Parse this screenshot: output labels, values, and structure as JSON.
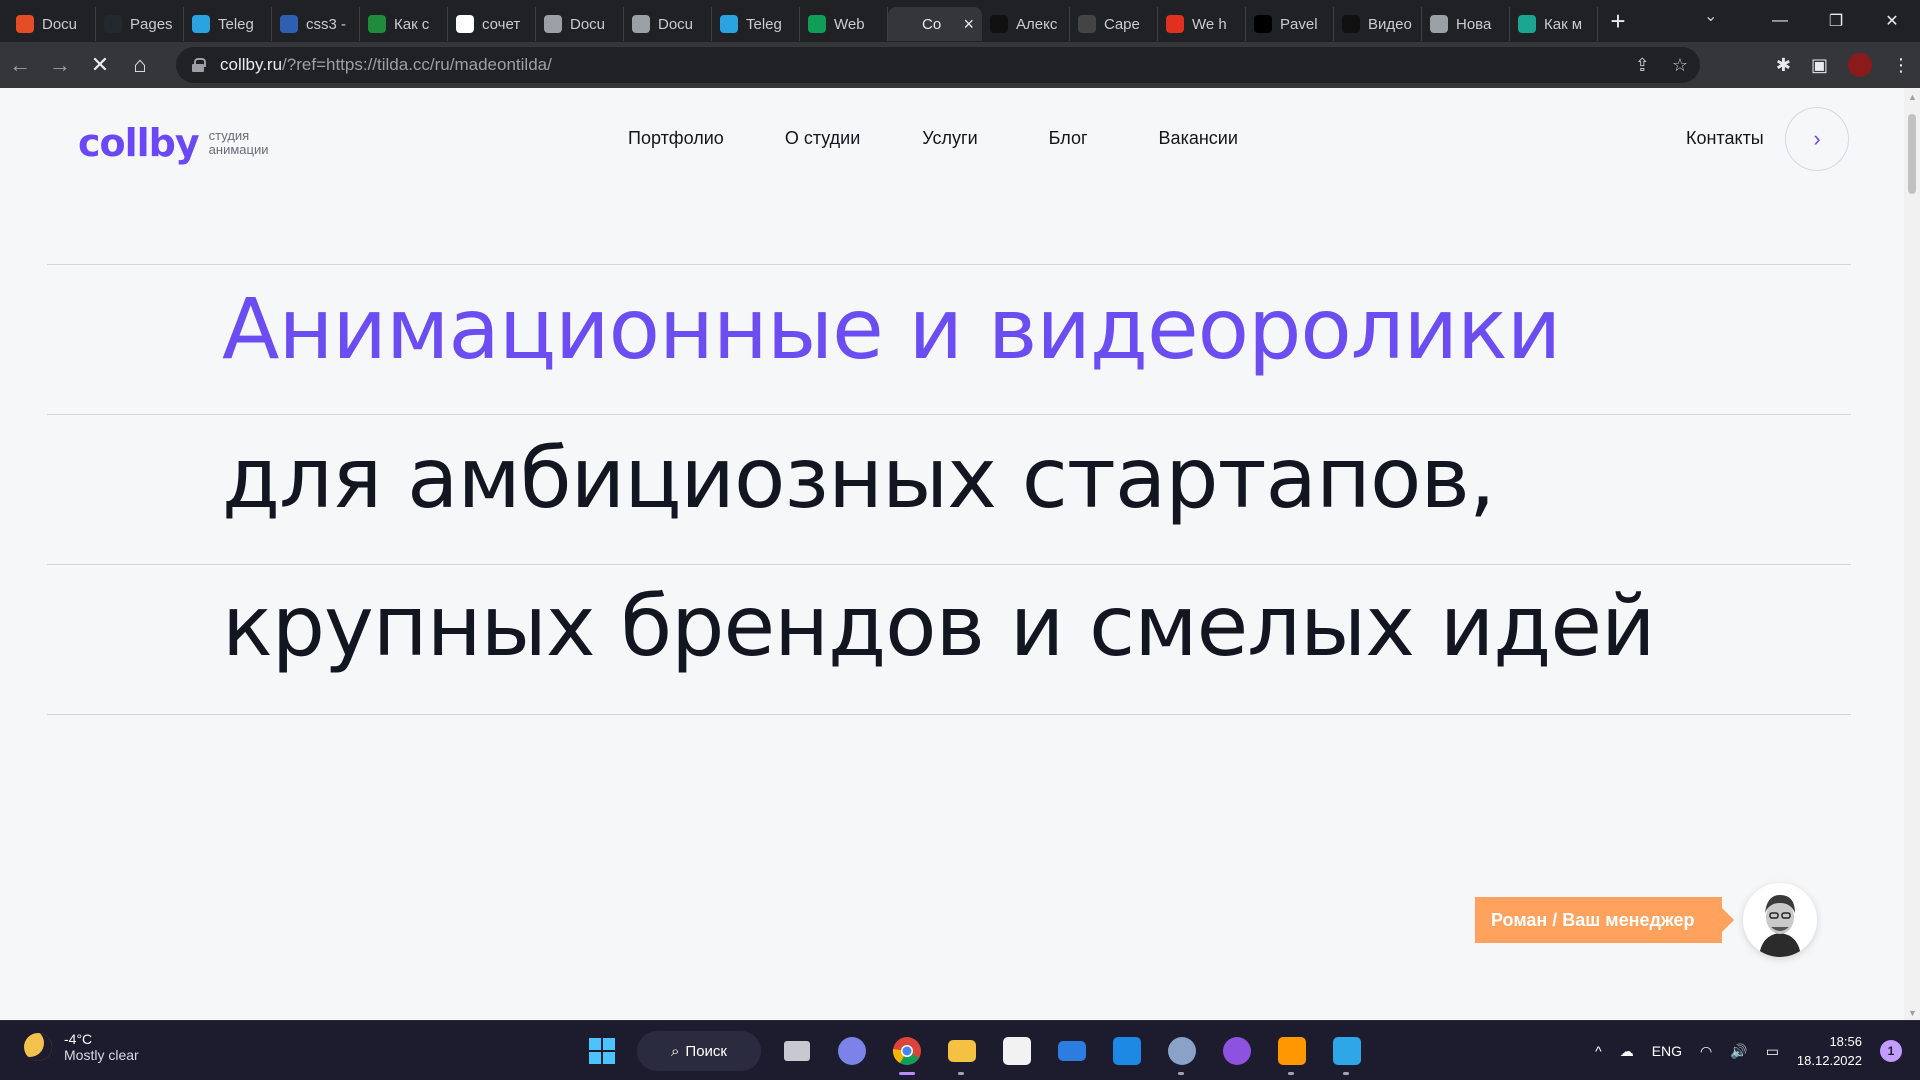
{
  "browser": {
    "tabs": [
      {
        "title": "Docu",
        "fav_color": "#e44d26",
        "icon": "html5-icon"
      },
      {
        "title": "Pages",
        "fav_color": "#24292f",
        "icon": "github-icon"
      },
      {
        "title": "Teleg",
        "fav_color": "#2aa3e0",
        "icon": "telegram-icon"
      },
      {
        "title": "css3 -",
        "fav_color": "#2f5fb3",
        "icon": "css-icon"
      },
      {
        "title": "Как с",
        "fav_color": "#1f8c3a",
        "icon": "tilda-icon"
      },
      {
        "title": "сочет",
        "fav_color": "#ffffff",
        "icon": "google-icon"
      },
      {
        "title": "Docu",
        "fav_color": "#9aa0a6",
        "icon": "globe-icon"
      },
      {
        "title": "Docu",
        "fav_color": "#9aa0a6",
        "icon": "globe-icon"
      },
      {
        "title": "Teleg",
        "fav_color": "#2aa3e0",
        "icon": "telegram-icon"
      },
      {
        "title": "Web",
        "fav_color": "#0f9d58",
        "icon": "sheets-icon"
      },
      {
        "title": "Co",
        "fav_color": "#35363a",
        "icon": "loading-icon",
        "active": true
      },
      {
        "title": "Алекс",
        "fav_color": "#111111",
        "icon": "site-icon"
      },
      {
        "title": "Cape",
        "fav_color": "#444444",
        "icon": "triangle-icon"
      },
      {
        "title": "We h",
        "fav_color": "#e0301e",
        "icon": "star-icon"
      },
      {
        "title": "Pavel",
        "fav_color": "#000000",
        "icon": "square-icon"
      },
      {
        "title": "Видео",
        "fav_color": "#111111",
        "icon": "behance-icon"
      },
      {
        "title": "Нова",
        "fav_color": "#9aa0a6",
        "icon": "chrome-icon"
      },
      {
        "title": "Как м",
        "fav_color": "#1aa690",
        "icon": "book-icon"
      }
    ],
    "url_host": "collby.ru",
    "url_rest": "/?ref=https://tilda.cc/ru/madeontilda/"
  },
  "site": {
    "logo_word": "collby",
    "logo_sub_1": "студия",
    "logo_sub_2": "анимации",
    "nav": [
      "Портфолио",
      "О студии",
      "Услуги",
      "Блог",
      "Вакансии"
    ],
    "contacts": "Контакты",
    "headline_1": "Анимационные и видеоролики",
    "headline_2": "для амбициозных стартапов,",
    "headline_3": "крупных брендов и смелых идей",
    "manager_label": "Роман / Ваш менеджер",
    "accent_color": "#6c4df2",
    "manager_color": "#ffa25e"
  },
  "taskbar": {
    "temp": "-4°C",
    "weather": "Mostly clear",
    "search": "Поиск",
    "lang": "ENG",
    "time": "18:56",
    "date": "18.12.2022",
    "notifications": "1"
  }
}
